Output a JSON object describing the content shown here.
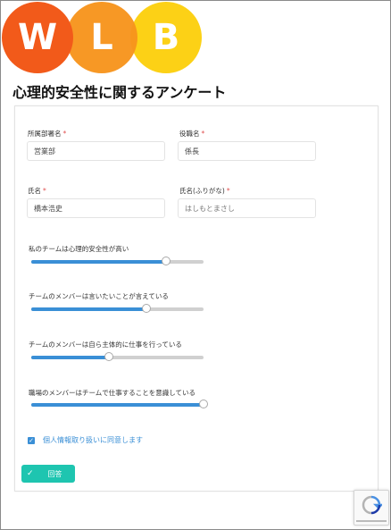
{
  "logo": {
    "letters": [
      "W",
      "L",
      "B"
    ]
  },
  "page_title": "心理的安全性に関するアンケート",
  "fields": {
    "department": {
      "label": "所属部署名",
      "value": "営業部"
    },
    "position": {
      "label": "役職名",
      "value": "係長"
    },
    "name": {
      "label": "氏名",
      "value": "橋本浩史"
    },
    "name_kana": {
      "label": "氏名(ふりがな)",
      "placeholder": "はしもとまさし"
    },
    "required_mark": "*"
  },
  "sliders": [
    {
      "label": "私のチームは心理的安全性が高い",
      "value_pct": 78
    },
    {
      "label": "チームのメンバーは言いたいことが言えている",
      "value_pct": 67
    },
    {
      "label": "チームのメンバーは自ら主体的に仕事を行っている",
      "value_pct": 45
    },
    {
      "label": "職場のメンバーはチームで仕事することを意識している",
      "value_pct": 100
    }
  ],
  "consent": {
    "label": "個人情報取り扱いに同意します",
    "checked": true
  },
  "submit": {
    "label": "回答"
  },
  "colors": {
    "accent": "#3a8fd6",
    "submit": "#1ec5b0",
    "logo": [
      "#f25a1a",
      "#f7941d",
      "#fcd116"
    ]
  }
}
